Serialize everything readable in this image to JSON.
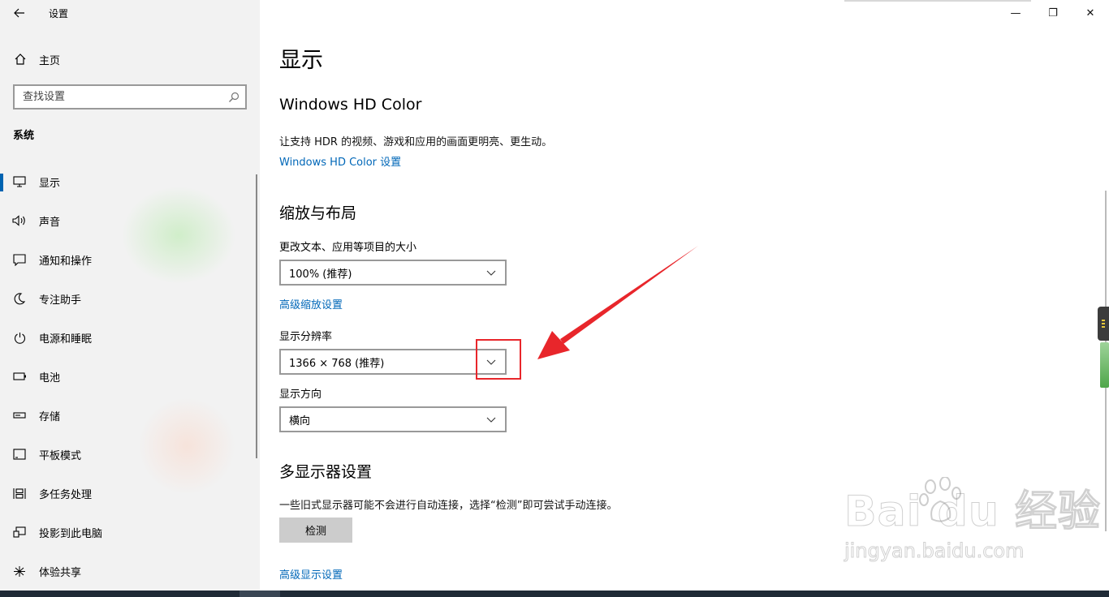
{
  "window": {
    "app_title": "设置",
    "back_icon": "arrow-left-icon",
    "controls": {
      "minimize": "—",
      "restore": "❐",
      "close": "✕"
    }
  },
  "sidebar": {
    "home": {
      "label": "主页",
      "icon": "home-icon"
    },
    "search": {
      "placeholder": "查找设置",
      "icon": "search-icon"
    },
    "section": "系统",
    "items": [
      {
        "label": "显示",
        "icon": "monitor-icon",
        "selected": true
      },
      {
        "label": "声音",
        "icon": "speaker-icon"
      },
      {
        "label": "通知和操作",
        "icon": "message-icon"
      },
      {
        "label": "专注助手",
        "icon": "moon-icon"
      },
      {
        "label": "电源和睡眠",
        "icon": "power-icon"
      },
      {
        "label": "电池",
        "icon": "battery-icon"
      },
      {
        "label": "存储",
        "icon": "storage-icon"
      },
      {
        "label": "平板模式",
        "icon": "tablet-icon"
      },
      {
        "label": "多任务处理",
        "icon": "multitask-icon"
      },
      {
        "label": "投影到此电脑",
        "icon": "project-icon"
      },
      {
        "label": "体验共享",
        "icon": "share-icon"
      }
    ]
  },
  "main": {
    "title": "显示",
    "hdr": {
      "heading": "Windows HD Color",
      "description": "让支持 HDR 的视频、游戏和应用的画面更明亮、更生动。",
      "link": "Windows HD Color 设置"
    },
    "scale": {
      "heading": "缩放与布局",
      "size_label": "更改文本、应用等项目的大小",
      "size_value": "100% (推荐)",
      "advanced_link": "高级缩放设置",
      "resolution_label": "显示分辨率",
      "resolution_value": "1366 × 768 (推荐)",
      "orientation_label": "显示方向",
      "orientation_value": "横向"
    },
    "multi": {
      "heading": "多显示器设置",
      "description": "一些旧式显示器可能不会进行自动连接，选择“检测”即可尝试手动连接。",
      "detect_button": "检测",
      "advanced_link": "高级显示设置"
    }
  },
  "watermark": {
    "main": "Bai  du 经验",
    "sub": "jingyan.baidu.com"
  },
  "colors": {
    "accent": "#0063b1",
    "link": "#0067b8",
    "annotation": "#e8262b"
  }
}
